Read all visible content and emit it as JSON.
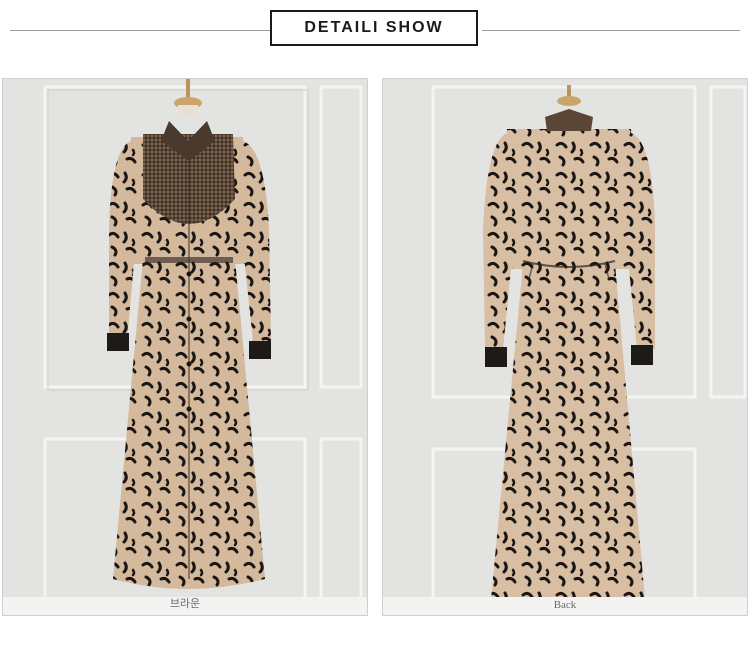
{
  "header": {
    "title": "DETAILI SHOW"
  },
  "photos": [
    {
      "caption": "브라운",
      "view": "front"
    },
    {
      "caption": "Back",
      "view": "back"
    }
  ],
  "colors": {
    "wall": "#e3e3e1",
    "dress_base": "#d4b99c",
    "print": "#1a1614",
    "yoke": "#5a4636",
    "cuff": "#1e1a18"
  }
}
